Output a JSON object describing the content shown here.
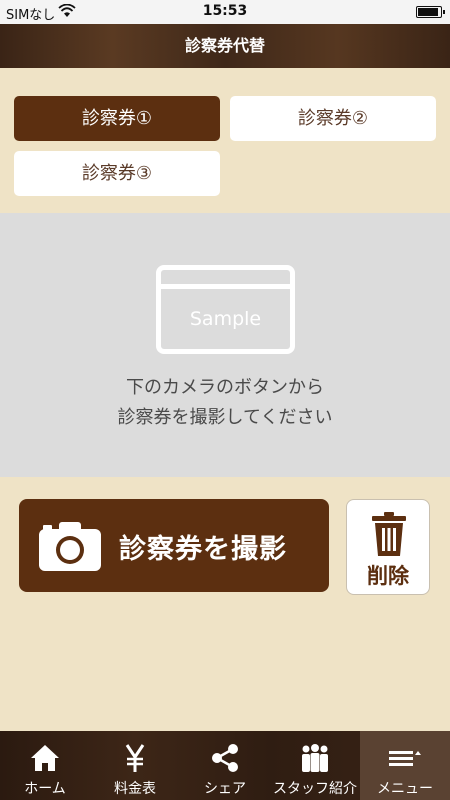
{
  "status_bar": {
    "carrier": "SIMなし",
    "time": "15:53"
  },
  "header": {
    "title": "診察券代替"
  },
  "tabs": [
    {
      "label": "診察券①",
      "active": true
    },
    {
      "label": "診察券②",
      "active": false
    },
    {
      "label": "診察券③",
      "active": false
    }
  ],
  "preview": {
    "card_text": "Sample",
    "instruction_line1": "下のカメラのボタンから",
    "instruction_line2": "診察券を撮影してください"
  },
  "actions": {
    "capture_label": "診察券を撮影",
    "delete_label": "削除"
  },
  "tabbar": [
    {
      "label": "ホーム",
      "icon": "home-icon"
    },
    {
      "label": "料金表",
      "icon": "yen-icon"
    },
    {
      "label": "シェア",
      "icon": "share-icon"
    },
    {
      "label": "スタッフ紹介",
      "icon": "staff-icon"
    },
    {
      "label": "メニュー",
      "icon": "menu-icon"
    }
  ],
  "colors": {
    "brand_brown": "#5c2f10",
    "background_beige": "#efe3c6",
    "preview_gray": "#dcdcdc"
  }
}
